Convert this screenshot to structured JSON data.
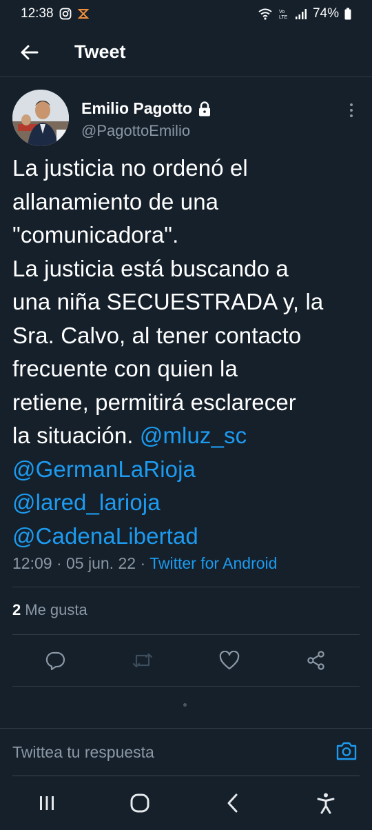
{
  "status_bar": {
    "time": "12:38",
    "battery": "74%",
    "icons": [
      "instagram-icon",
      "app-notification-icon",
      "wifi-icon",
      "volte-icon",
      "signal-icon",
      "battery-icon"
    ]
  },
  "header": {
    "title": "Tweet",
    "back_icon": "arrow-left-icon"
  },
  "tweet": {
    "author": {
      "name": "Emilio Pagotto",
      "handle": "@PagottoEmilio",
      "protected_icon": "lock-icon"
    },
    "lines": [
      "La justicia no ordenó el",
      "allanamiento de una",
      "\"comunicadora\".",
      "La justicia está buscando a",
      "una niña SECUESTRADA y, la",
      "Sra. Calvo, al tener contacto",
      "frecuente con quien la",
      "retiene, permitirá esclarecer",
      "la situación."
    ],
    "mentions": [
      "@mluz_sc",
      "@GermanLaRioja",
      "@lared_larioja",
      "@CadenaLibertad"
    ],
    "time": "12:09",
    "date": "05 jun. 22",
    "source": "Twitter for Android",
    "separator": "·",
    "likes_count": "2",
    "likes_label": "Me gusta"
  },
  "actions": {
    "icons": [
      "reply-icon",
      "retweet-icon",
      "like-icon",
      "share-icon"
    ]
  },
  "reply": {
    "placeholder": "Twittea tu respuesta",
    "camera_icon": "camera-icon"
  },
  "nav": {
    "icons": [
      "recent-apps-icon",
      "home-icon",
      "back-icon",
      "accessibility-icon"
    ]
  },
  "colors": {
    "background": "#15202b",
    "link": "#1d9bf0",
    "secondary_text": "#8b98a5",
    "divider": "#2f3b47"
  }
}
